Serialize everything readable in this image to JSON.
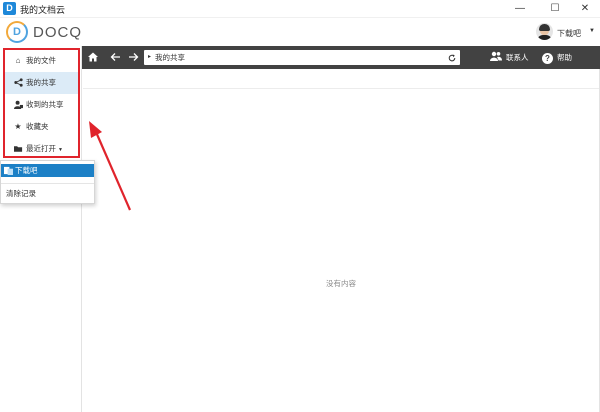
{
  "window": {
    "app_icon_letter": "D",
    "title": "我的文档云",
    "minimize": "—",
    "maximize": "☐",
    "close": "✕"
  },
  "header": {
    "logo_mark": "D",
    "logo_text": "DOCQ",
    "user_name": "下载吧",
    "user_caret": "▼"
  },
  "sidebar": {
    "items": [
      {
        "icon": "home-icon",
        "glyph": "⌂",
        "label": "我的文件",
        "active": false
      },
      {
        "icon": "share-icon",
        "glyph": "⋖",
        "label": "我的共享",
        "active": true
      },
      {
        "icon": "received-share-icon",
        "glyph": "⇩",
        "label": "收到的共享",
        "active": false
      },
      {
        "icon": "star-icon",
        "glyph": "★",
        "label": "收藏夹",
        "active": false
      },
      {
        "icon": "folder-open-icon",
        "glyph": "▬",
        "label": "最近打开",
        "active": false,
        "caret": "▼"
      }
    ]
  },
  "recent_popup": {
    "recent_item": "下载吧",
    "clear_label": "清除记录"
  },
  "toolbar": {
    "breadcrumb_sep": "▸",
    "breadcrumb": "我的共享",
    "contacts_label": "联系人",
    "help_label": "帮助",
    "help_glyph": "?"
  },
  "content": {
    "empty_text": "没有内容"
  },
  "colors": {
    "toolbar_bg": "#424242",
    "active_nav_bg": "#dcebf7",
    "popup_highlight": "#1c80c6",
    "annotation_red": "#e0242c"
  }
}
